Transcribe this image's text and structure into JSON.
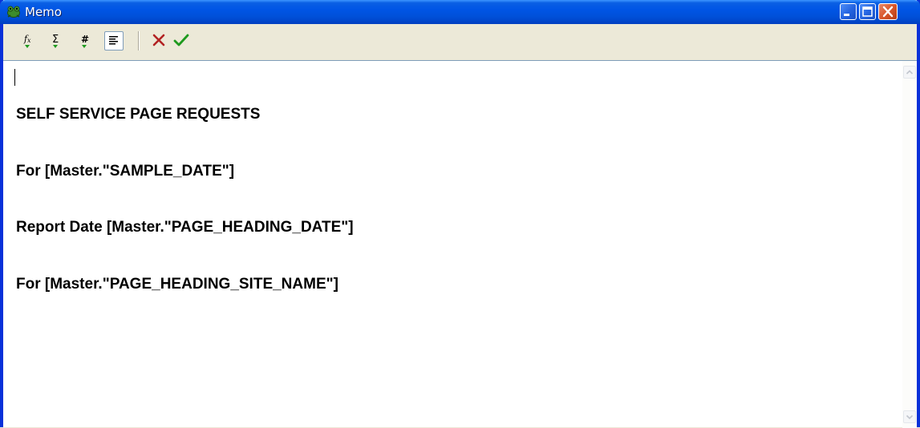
{
  "window": {
    "title": "Memo",
    "app_icon": "frog-icon"
  },
  "titlebar_buttons": [
    "minimize-icon",
    "maximize-icon",
    "close-icon"
  ],
  "toolbar": {
    "tools": [
      {
        "name": "insert-function",
        "icon": "fx-icon"
      },
      {
        "name": "insert-aggregate",
        "icon": "sigma-icon"
      },
      {
        "name": "insert-format",
        "icon": "hash-icon"
      },
      {
        "name": "word-wrap",
        "icon": "align-text-icon",
        "active": true
      },
      {
        "name": "cancel",
        "icon": "cross-icon"
      },
      {
        "name": "ok",
        "icon": "check-icon"
      }
    ]
  },
  "memo": {
    "lines": [
      "SELF SERVICE PAGE REQUESTS",
      "For [Master.\"SAMPLE_DATE\"]",
      "Report Date [Master.\"PAGE_HEADING_DATE\"]",
      "For [Master.\"PAGE_HEADING_SITE_NAME\"]"
    ]
  },
  "colors": {
    "titlebar": "#0055e5",
    "cancel": "#b22222",
    "ok": "#1e9a1e",
    "dropdown_arrow": "#1e9a1e"
  }
}
